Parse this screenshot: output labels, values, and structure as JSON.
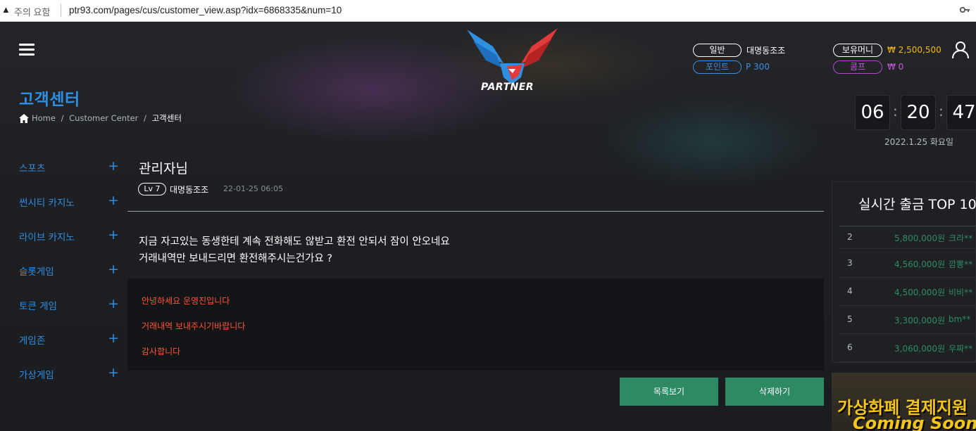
{
  "browser": {
    "warning_text": "주의 요함",
    "url": "ptr93.com/pages/cus/customer_view.asp?idx=6868335&num=10"
  },
  "header": {
    "logo_text": "PARTNER",
    "grade_label": "일반",
    "nickname": "대명동조조",
    "point_label": "포인트",
    "point_value": "P 300",
    "money_label": "보유머니",
    "money_value": "₩ 2,500,500",
    "comp_label": "콤프",
    "comp_value": "₩ 0"
  },
  "page": {
    "title": "고객센터",
    "breadcrumb": {
      "home": "Home",
      "sep1": " / ",
      "section": "Customer Center",
      "sep2": " / ",
      "current": "고객센터"
    }
  },
  "clock": {
    "hh": "06",
    "mm": "20",
    "ss": "47",
    "date": "2022.1.25 화요일"
  },
  "sidebar": {
    "items": [
      {
        "label": "스포츠"
      },
      {
        "label": "썬시티 카지노"
      },
      {
        "label": "라이브 카지노"
      },
      {
        "label": "슬롯게임"
      },
      {
        "label": "토큰 게임"
      },
      {
        "label": "게임존"
      },
      {
        "label": "가상게임"
      }
    ],
    "plus": "+"
  },
  "post": {
    "title": "관리자님",
    "level": "Lv 7",
    "author": "대명동조조",
    "date": "22-01-25 06:05",
    "body_line1": "지금 자고있는 동생한테 계속 전화해도 않받고 환전 안되서 잠이 안오네요",
    "body_line2": "거래내역만 보내드리면 환전해주시는건가요 ?",
    "reply": [
      "안녕하세요 운영진입니다",
      "거래내역 보내주시기바랍니다",
      "감사합니다"
    ],
    "list_button": "목록보기",
    "delete_button": "삭제하기"
  },
  "ranking": {
    "title": "실시간 출금 TOP 10",
    "rows": [
      {
        "rank": "2",
        "amount": "5,800,000원",
        "name": "크라**"
      },
      {
        "rank": "3",
        "amount": "4,560,000원",
        "name": "깜뽕**"
      },
      {
        "rank": "4",
        "amount": "4,500,000원",
        "name": "비비**"
      },
      {
        "rank": "5",
        "amount": "3,300,000원",
        "name": "bm**"
      },
      {
        "rank": "6",
        "amount": "3,060,000원",
        "name": "우짜**"
      }
    ]
  },
  "banner": {
    "line1": "가상화폐 결제지원",
    "line2": "Coming Soon"
  },
  "colors": {
    "accent_blue": "#2e8fe2",
    "button_green": "#2e8a62",
    "reply_red": "#ff5533",
    "money_gold": "#f5b800",
    "comp_purple": "#c25ad8"
  }
}
